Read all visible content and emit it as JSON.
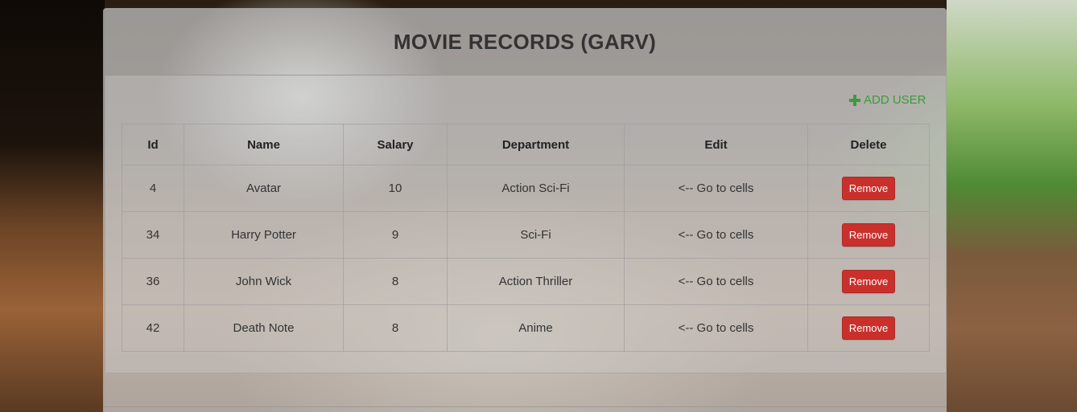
{
  "header": {
    "title": "MOVIE RECORDS (GARV)"
  },
  "actions": {
    "add_user_label": "ADD USER",
    "add_user_icon": "plus-icon",
    "accent_color": "#3c9a3c"
  },
  "table": {
    "columns": [
      "Id",
      "Name",
      "Salary",
      "Department",
      "Edit",
      "Delete"
    ],
    "rows": [
      {
        "id": "4",
        "name": "Avatar",
        "salary": "10",
        "department": "Action Sci-Fi",
        "edit": "<-- Go to cells",
        "delete_label": "Remove"
      },
      {
        "id": "34",
        "name": "Harry Potter",
        "salary": "9",
        "department": "Sci-Fi",
        "edit": "<-- Go to cells",
        "delete_label": "Remove"
      },
      {
        "id": "36",
        "name": "John Wick",
        "salary": "8",
        "department": "Action Thriller",
        "edit": "<-- Go to cells",
        "delete_label": "Remove"
      },
      {
        "id": "42",
        "name": "Death Note",
        "salary": "8",
        "department": "Anime",
        "edit": "<-- Go to cells",
        "delete_label": "Remove"
      }
    ],
    "delete_button_color": "#c9302c"
  }
}
